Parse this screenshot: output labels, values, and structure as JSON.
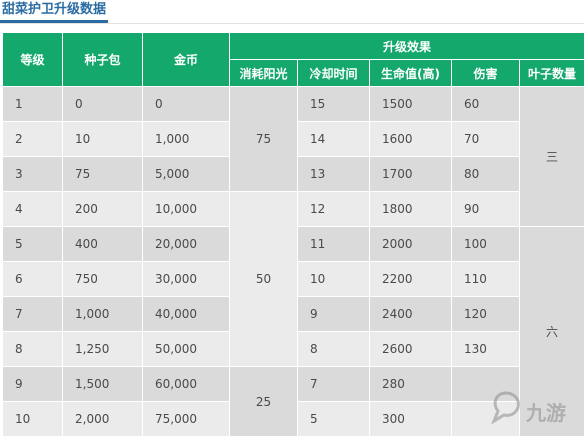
{
  "page_title": "甜菜护卫升级数据",
  "headers": {
    "level": "等级",
    "seed_pack": "种子包",
    "coins": "金币",
    "upgrade_effect": "升级效果",
    "sun_cost": "消耗阳光",
    "cooldown": "冷却时间",
    "health": "生命值(高)",
    "damage": "伤害",
    "leaf_count": "叶子数量"
  },
  "rows": [
    {
      "level": "1",
      "seed_pack": "0",
      "coins": "0",
      "cooldown": "15",
      "health": "1500",
      "damage": "60"
    },
    {
      "level": "2",
      "seed_pack": "10",
      "coins": "1,000",
      "cooldown": "14",
      "health": "1600",
      "damage": "70"
    },
    {
      "level": "3",
      "seed_pack": "75",
      "coins": "5,000",
      "cooldown": "13",
      "health": "1700",
      "damage": "80"
    },
    {
      "level": "4",
      "seed_pack": "200",
      "coins": "10,000",
      "cooldown": "12",
      "health": "1800",
      "damage": "90"
    },
    {
      "level": "5",
      "seed_pack": "400",
      "coins": "20,000",
      "cooldown": "11",
      "health": "2000",
      "damage": "100"
    },
    {
      "level": "6",
      "seed_pack": "750",
      "coins": "30,000",
      "cooldown": "10",
      "health": "2200",
      "damage": "110"
    },
    {
      "level": "7",
      "seed_pack": "1,000",
      "coins": "40,000",
      "cooldown": "9",
      "health": "2400",
      "damage": "120"
    },
    {
      "level": "8",
      "seed_pack": "1,250",
      "coins": "50,000",
      "cooldown": "8",
      "health": "2600",
      "damage": "130"
    },
    {
      "level": "9",
      "seed_pack": "1,500",
      "coins": "60,000",
      "cooldown": "7",
      "health": "280",
      "damage": ""
    },
    {
      "level": "10",
      "seed_pack": "2,000",
      "coins": "75,000",
      "cooldown": "5",
      "health": "300",
      "damage": ""
    }
  ],
  "sun_groups": [
    {
      "value": "75"
    },
    {
      "value": "50"
    },
    {
      "value": "25"
    }
  ],
  "leaf_groups": [
    {
      "value": "三"
    },
    {
      "value": "六"
    }
  ],
  "watermark_text": "九游",
  "colors": {
    "header_bg": "#14a86d",
    "title_blue": "#2b6ca3",
    "row_dark": "#dadada",
    "row_light": "#ebebeb"
  }
}
